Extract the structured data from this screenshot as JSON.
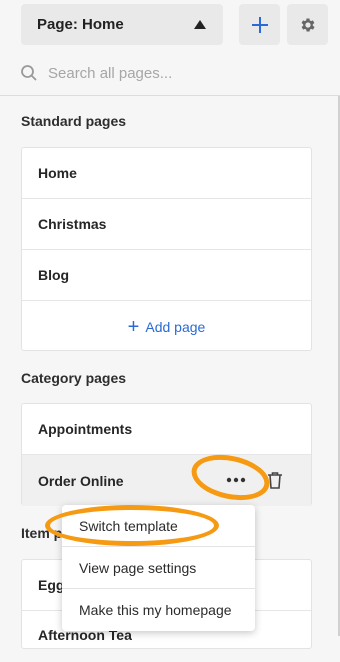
{
  "header": {
    "page_select_label": "Page: Home",
    "search_placeholder": "Search all pages..."
  },
  "standard_pages": {
    "title": "Standard pages",
    "items": [
      "Home",
      "Christmas",
      "Blog"
    ],
    "add_page_label": "Add page"
  },
  "category_pages": {
    "title": "Category pages",
    "items": [
      "Appointments",
      "Order Online"
    ]
  },
  "item_pages": {
    "title_visible": "Item p",
    "items": [
      "Egg",
      "Afternoon Tea"
    ]
  },
  "context_menu": {
    "items": [
      "Switch template",
      "View page settings",
      "Make this my homepage"
    ]
  },
  "colors": {
    "accent_blue": "#2a6ad6",
    "highlight_orange": "#f59a12"
  }
}
